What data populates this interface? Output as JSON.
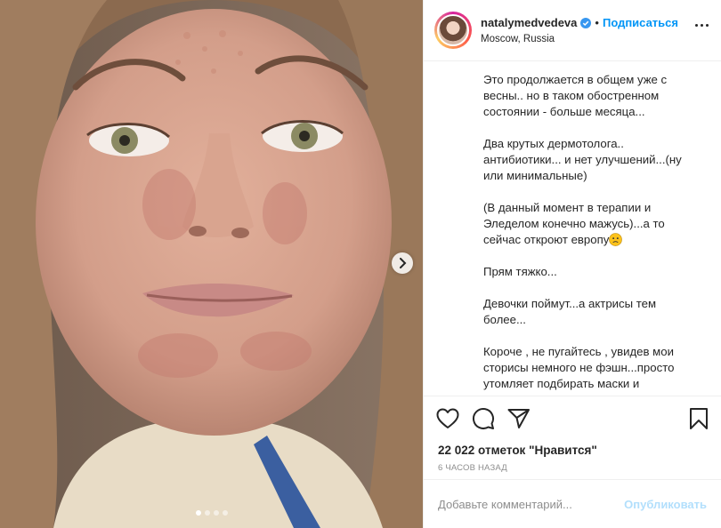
{
  "media": {
    "image_alt": "Selfie photo",
    "carousel": {
      "count": 4,
      "active_index": 0
    }
  },
  "header": {
    "username": "natalymedvedeva",
    "separator": "•",
    "follow_label": "Подписаться",
    "location": "Moscow, Russia",
    "verified": true
  },
  "caption": {
    "paragraphs": [
      "Это продолжается в общем уже с весны.. но в таком обостренном состоянии - больше месяца...",
      "Два крутых дермотолога.. антибиотики... и нет улучшений...(ну или минимальные)",
      "(В данный момент в терапии и Эледелом конечно мажусь)...а то сейчас откроют европу",
      "Прям тяжко...",
      "Девочки поймут...а актрисы тем более...",
      "Короче , не пугайтесь , увидев мои сторисы немного не фэшн...просто утомляет подбирать маски и"
    ]
  },
  "actions": {
    "like_icon": "heart-icon",
    "comment_icon": "comment-icon",
    "share_icon": "share-icon",
    "save_icon": "bookmark-icon"
  },
  "likes": {
    "text": "22 022 отметок \"Нравится\""
  },
  "time": {
    "text": "6 часов назад"
  },
  "comment": {
    "placeholder": "Добавьте комментарий...",
    "publish_label": "Опубликовать"
  },
  "colors": {
    "accent": "#0095f6",
    "publish_disabled": "#b2dffc",
    "text": "#262626",
    "muted": "#8e8e8e"
  }
}
